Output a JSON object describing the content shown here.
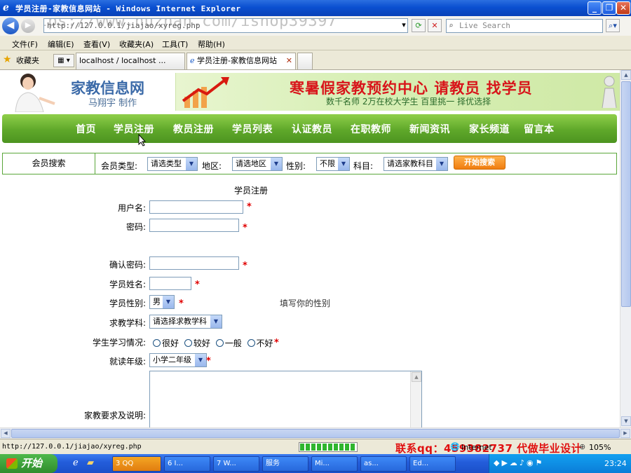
{
  "window": {
    "title": "学员注册-家教信息网站 - Windows Internet Explorer"
  },
  "browser": {
    "address": "http://127.0.0.1/jiajao/xyreg.php",
    "watermark": "https://www.huzhan.com/ishop39397",
    "search_placeholder": "Live Search",
    "menu": [
      "文件(F)",
      "编辑(E)",
      "查看(V)",
      "收藏夹(A)",
      "工具(T)",
      "帮助(H)"
    ],
    "favorites_label": "收藏夹",
    "tabs": [
      {
        "label": "localhost / localhost ..."
      },
      {
        "label": "学员注册-家教信息网站"
      }
    ]
  },
  "site": {
    "logo_title": "家教信息网",
    "logo_author": "马翔宇 制作",
    "ad_headline": "寒暑假家教预约中心 请教员 找学员",
    "ad_subline": "数千名师 2万在校大学生 百里挑一 择优选择",
    "nav": [
      "首页",
      "学员注册",
      "教员注册",
      "学员列表",
      "认证教员",
      "在职教师",
      "新闻资讯",
      "家长频道",
      "留言本"
    ]
  },
  "member_search": {
    "title": "会员搜索",
    "type_label": "会员类型:",
    "type_value": "请选类型",
    "area_label": "地区:",
    "area_value": "请选地区",
    "gender_label": "性别:",
    "gender_value": "不限",
    "subject_label": "科目:",
    "subject_value": "请选家教科目",
    "search_button": "开始搜索"
  },
  "form": {
    "heading": "学员注册",
    "username_label": "用户名:",
    "password_label": "密码:",
    "confirm_label": "确认密码:",
    "name_label": "学员姓名:",
    "gender_label": "学员性别:",
    "gender_value": "男",
    "gender_hint": "填写你的性别",
    "subject_label": "求教学科:",
    "subject_value": "请选择求教学科",
    "study_label": "学生学习情况:",
    "study_options": [
      "很好",
      "较好",
      "一般",
      "不好"
    ],
    "grade_label": "就读年级:",
    "grade_value": "小学二年级",
    "requirements_label": "家教要求及说明:",
    "required_mark": "*"
  },
  "status": {
    "url": "http://127.0.0.1/jiajao/xyreg.php",
    "zone": "Internet",
    "zoom": "105%",
    "overlay_contact": "联系qq：459382737 代做毕业设计"
  },
  "taskbar": {
    "start": "开始",
    "items": [
      "3 QQ",
      "6 I...",
      "7 W...",
      "服务",
      "Mi...",
      "as...",
      "Ed..."
    ],
    "clock": "23:24"
  }
}
